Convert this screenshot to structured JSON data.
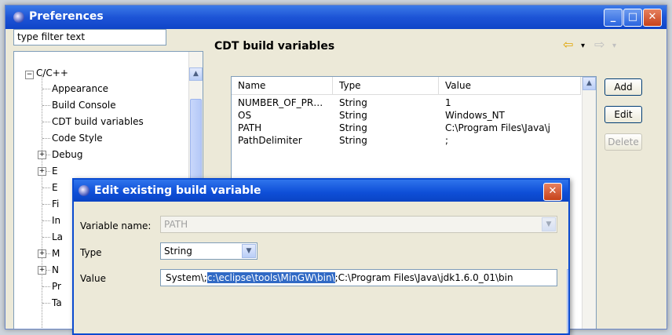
{
  "window": {
    "title": "Preferences",
    "controls": {
      "minimize": "_",
      "maximize": "□",
      "close": "✕"
    }
  },
  "filter": {
    "value": "type filter text"
  },
  "tree": {
    "root": "C/C++",
    "items": [
      {
        "label": "Appearance",
        "expandable": false
      },
      {
        "label": "Build Console",
        "expandable": false
      },
      {
        "label": "CDT build variables",
        "expandable": false
      },
      {
        "label": "Code Style",
        "expandable": false
      },
      {
        "label": "Debug",
        "expandable": true
      },
      {
        "label": "E",
        "expandable": true
      },
      {
        "label": "E",
        "expandable": false
      },
      {
        "label": "Fi",
        "expandable": false
      },
      {
        "label": "In",
        "expandable": false
      },
      {
        "label": "La",
        "expandable": false
      },
      {
        "label": "M",
        "expandable": true
      },
      {
        "label": "N",
        "expandable": true
      },
      {
        "label": "Pr",
        "expandable": false
      },
      {
        "label": "Ta",
        "expandable": false
      }
    ]
  },
  "page": {
    "title": "CDT build variables"
  },
  "nav": {
    "back": "⇦",
    "forward": "⇨",
    "dropdown": "▾"
  },
  "table": {
    "columns": [
      "Name",
      "Type",
      "Value"
    ],
    "rows": [
      [
        "NUMBER_OF_PR…",
        "String",
        "1"
      ],
      [
        "OS",
        "String",
        "Windows_NT"
      ],
      [
        "PATH",
        "String",
        "C:\\Program Files\\Java\\j"
      ],
      [
        "PathDelimiter",
        "String",
        ";"
      ]
    ]
  },
  "buttons": {
    "add": "Add",
    "edit": "Edit",
    "delete": "Delete"
  },
  "dialog": {
    "title": "Edit existing build variable",
    "close": "✕",
    "name_label": "Variable name:",
    "name_value": "PATH",
    "type_label": "Type",
    "type_value": "String",
    "value_label": "Value",
    "value_before": "System\\;",
    "value_selected": "c:\\eclipse\\tools\\MinGW\\bin\\",
    "value_after": ";C:\\Program Files\\Java\\jdk1.6.0_01\\bin"
  },
  "colors": {
    "titlebar": "#1d54d6",
    "selection": "#316ac5",
    "dialog_border": "#0a4bd0"
  }
}
